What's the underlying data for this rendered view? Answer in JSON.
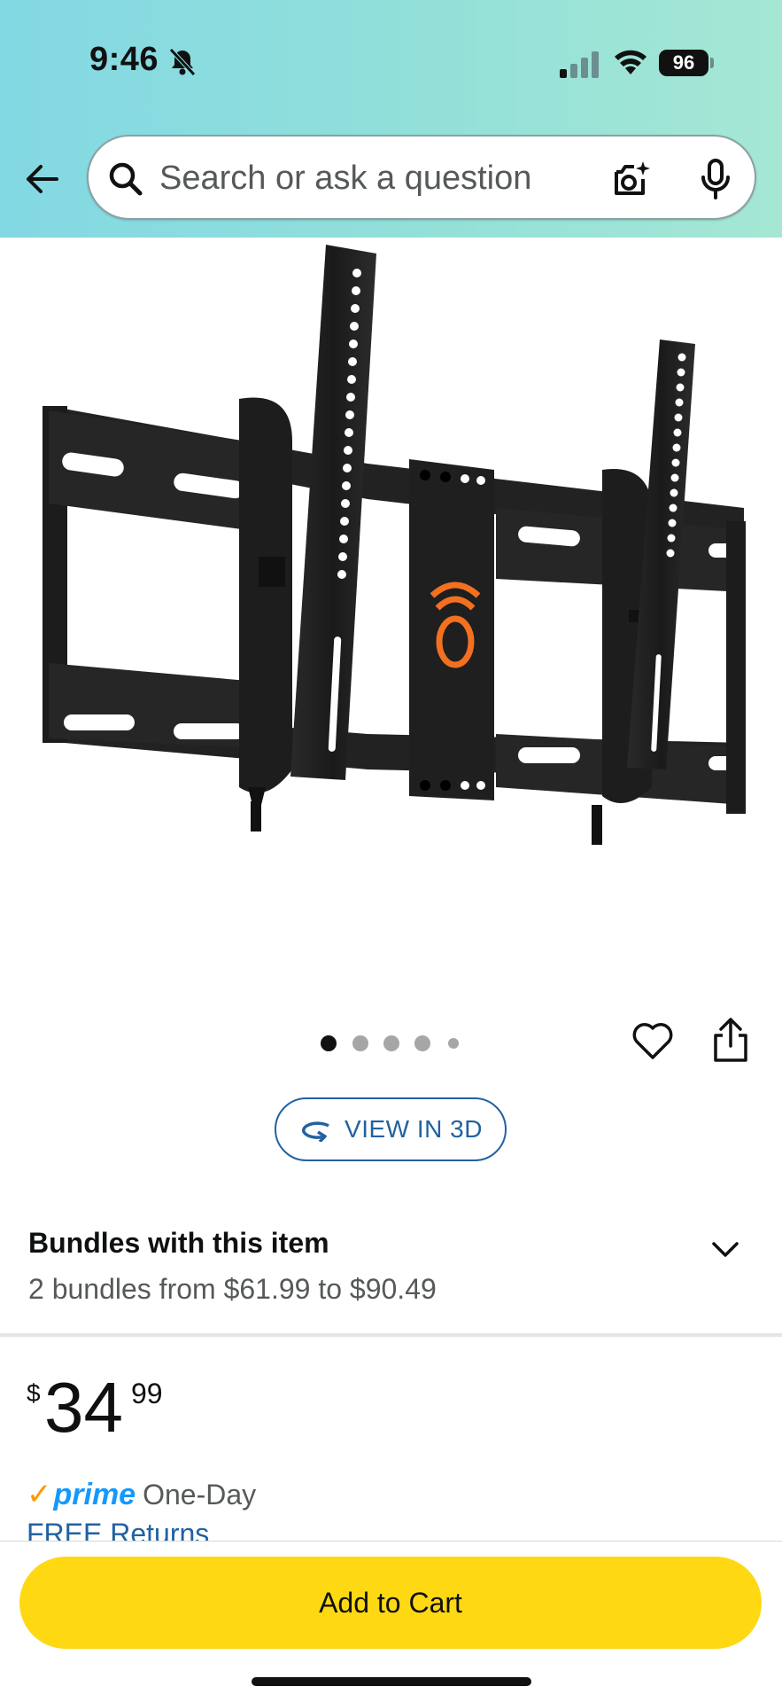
{
  "status_bar": {
    "time": "9:46",
    "battery": "96",
    "icons": [
      "bell-off-icon",
      "signal-icon",
      "wifi-icon",
      "battery-icon"
    ]
  },
  "header": {
    "search_placeholder": "Search or ask a question",
    "icons": [
      "back-arrow-icon",
      "search-icon",
      "camera-lens-icon",
      "microphone-icon"
    ]
  },
  "product": {
    "image_description_icon": "tv-wall-mount-image",
    "carousel": {
      "count": 5,
      "active_index": 0
    },
    "view_3d_label": "VIEW IN 3D"
  },
  "bundles": {
    "title": "Bundles with this item",
    "subtitle": "2 bundles from $61.99 to $90.49"
  },
  "price": {
    "symbol": "$",
    "whole": "34",
    "fraction": "99"
  },
  "delivery": {
    "prime_check": "✓",
    "prime_label": "prime",
    "speed": "One-Day",
    "returns": "FREE Returns"
  },
  "cart": {
    "add_to_cart_label": "Add to Cart"
  },
  "colors": {
    "accent_link": "#2162a1",
    "cart_button": "#ffd814",
    "prime_blue": "#1399ff",
    "prime_orange": "#ff9900"
  }
}
